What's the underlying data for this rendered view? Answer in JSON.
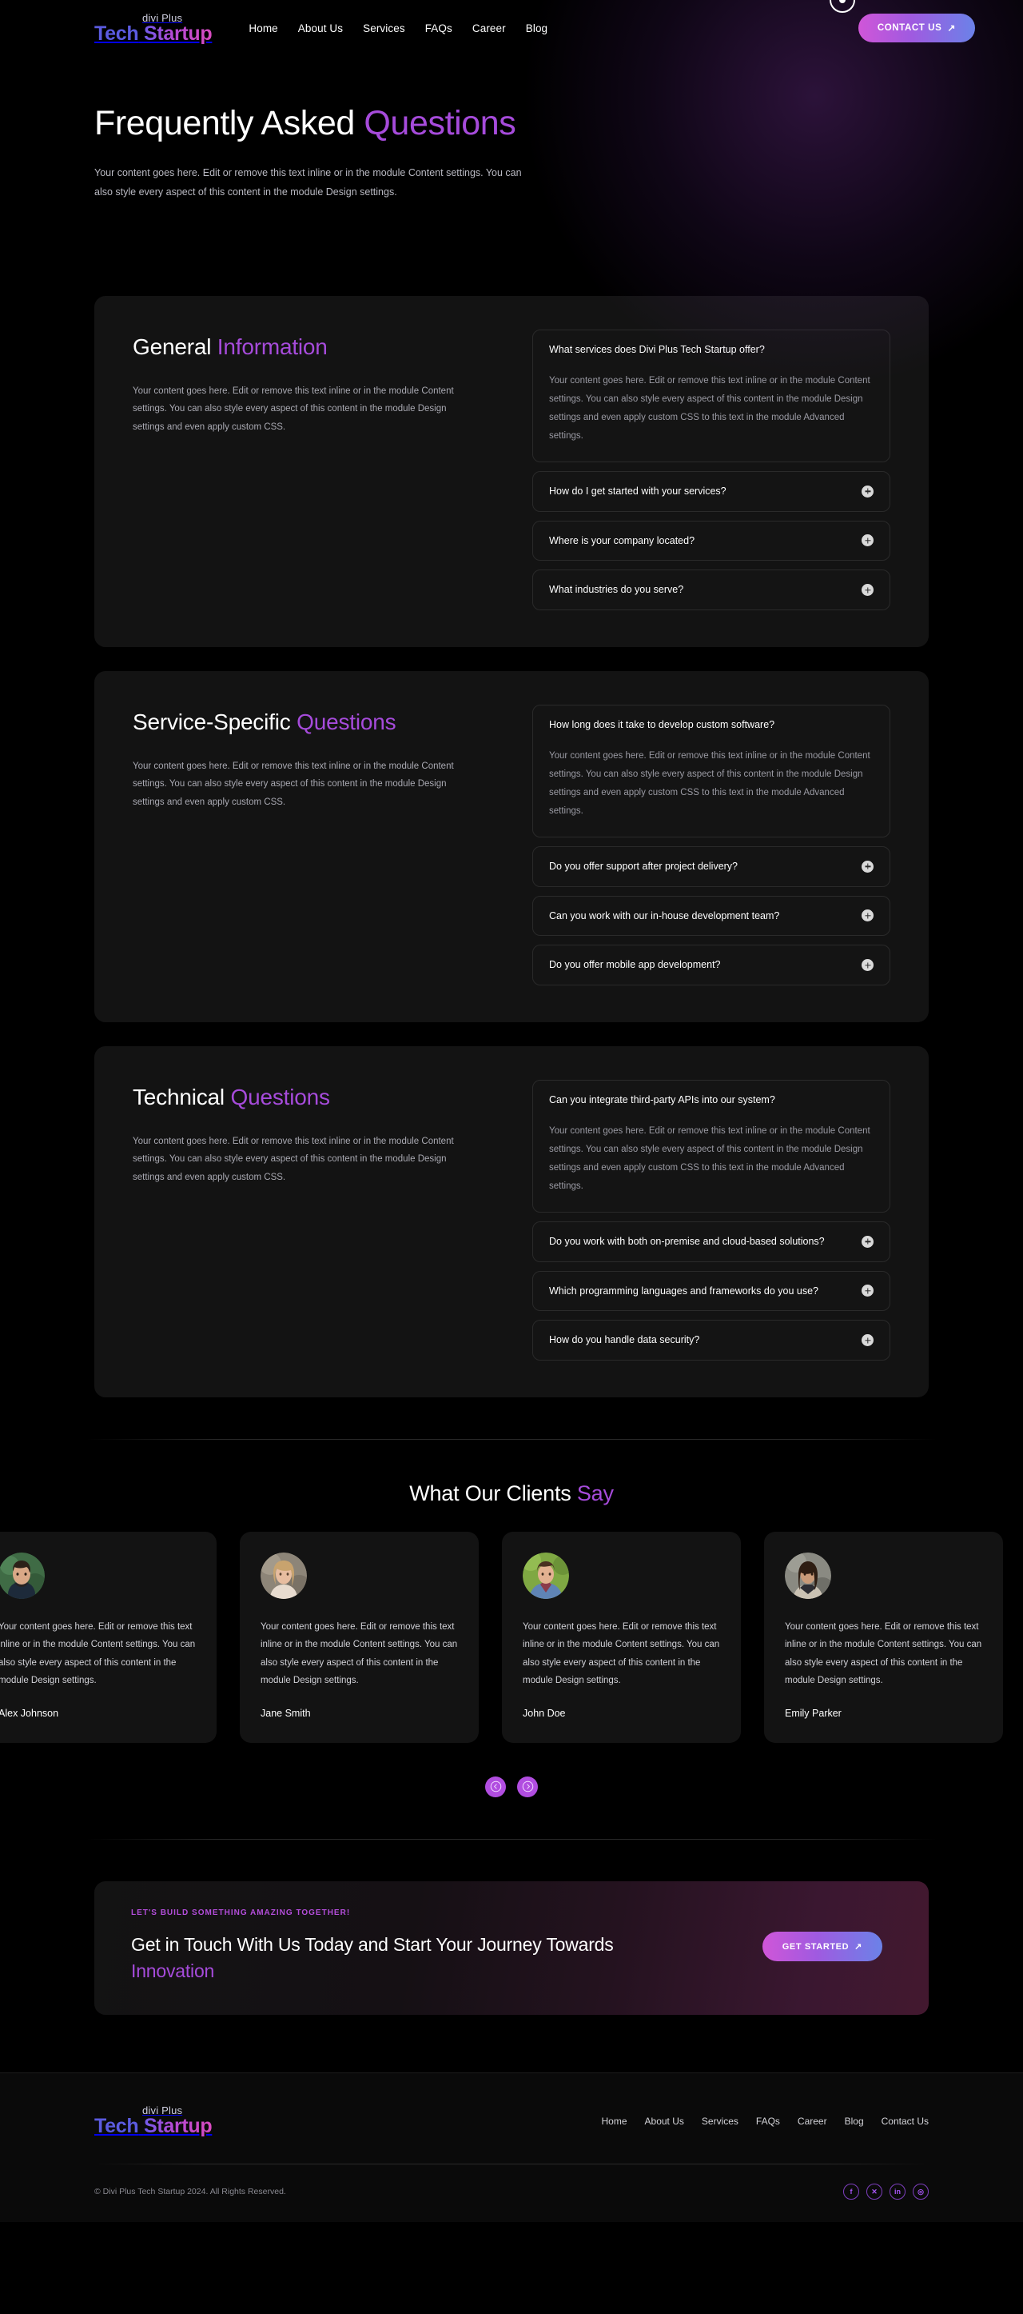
{
  "brand": {
    "sub": "divi Plus",
    "word1": "Tech",
    "word2": "Startup"
  },
  "header": {
    "nav": [
      {
        "label": "Home"
      },
      {
        "label": "About Us"
      },
      {
        "label": "Services"
      },
      {
        "label": "FAQs"
      },
      {
        "label": "Career"
      },
      {
        "label": "Blog"
      }
    ],
    "contact_label": "CONTACT US",
    "contact_arrow": "↗"
  },
  "hero": {
    "title_white": "Frequently Asked ",
    "title_accent": "Questions",
    "description": "Your content goes here. Edit or remove this text inline or in the module Content settings. You can also style every aspect of this content in the module Design settings."
  },
  "faq_sections": [
    {
      "title_white": "General ",
      "title_accent": "Information",
      "description": "Your content goes here. Edit or remove this text inline or in the module Content settings. You can also style every aspect of this content in the module Design settings and even apply custom CSS.",
      "items": [
        {
          "question": "What services does Divi Plus Tech Startup offer?",
          "answer": "Your content goes here. Edit or remove this text inline or in the module Content settings. You can also style every aspect of this content in the module Design settings and even apply custom CSS to this text in the module Advanced settings.",
          "open": true
        },
        {
          "question": "How do I get started with your services?",
          "answer": "",
          "open": false
        },
        {
          "question": "Where is your company located?",
          "answer": "",
          "open": false
        },
        {
          "question": "What industries do you serve?",
          "answer": "",
          "open": false
        }
      ]
    },
    {
      "title_white": "Service-Specific ",
      "title_accent": "Questions",
      "description": "Your content goes here. Edit or remove this text inline or in the module Content settings. You can also style every aspect of this content in the module Design settings and even apply custom CSS.",
      "items": [
        {
          "question": "How long does it take to develop custom software?",
          "answer": "Your content goes here. Edit or remove this text inline or in the module Content settings. You can also style every aspect of this content in the module Design settings and even apply custom CSS to this text in the module Advanced settings.",
          "open": true
        },
        {
          "question": "Do you offer support after project delivery?",
          "answer": "",
          "open": false
        },
        {
          "question": "Can you work with our in-house development team?",
          "answer": "",
          "open": false
        },
        {
          "question": "Do you offer mobile app development?",
          "answer": "",
          "open": false
        }
      ]
    },
    {
      "title_white": "Technical ",
      "title_accent": "Questions",
      "description": "Your content goes here. Edit or remove this text inline or in the module Content settings. You can also style every aspect of this content in the module Design settings and even apply custom CSS.",
      "items": [
        {
          "question": "Can you integrate third-party APIs into our system?",
          "answer": "Your content goes here. Edit or remove this text inline or in the module Content settings. You can also style every aspect of this content in the module Design settings and even apply custom CSS to this text in the module Advanced settings.",
          "open": true
        },
        {
          "question": "Do you work with both on-premise and cloud-based solutions?",
          "answer": "",
          "open": false
        },
        {
          "question": "Which programming languages and frameworks do you use?",
          "answer": "",
          "open": false
        },
        {
          "question": "How do you handle data security?",
          "answer": "",
          "open": false
        }
      ]
    }
  ],
  "testimonials": {
    "heading_white": "What Our Clients ",
    "heading_accent": "Say",
    "cards": [
      {
        "text": "Your content goes here. Edit or remove this text inline or in the module Content settings. You can also style every aspect of this content in the module Design settings.",
        "name": "Alex Johnson"
      },
      {
        "text": "Your content goes here. Edit or remove this text inline or in the module Content settings. You can also style every aspect of this content in the module Design settings.",
        "name": "Jane Smith"
      },
      {
        "text": "Your content goes here. Edit or remove this text inline or in the module Content settings. You can also style every aspect of this content in the module Design settings.",
        "name": "John Doe"
      },
      {
        "text": "Your content goes here. Edit or remove this text inline or in the module Content settings. You can also style every aspect of this content in the module Design settings.",
        "name": "Emily Parker"
      }
    ],
    "prev_label": "Previous",
    "next_label": "Next"
  },
  "cta": {
    "kicker": "LET'S BUILD SOMETHING AMAZING TOGETHER!",
    "title_white": "Get in Touch With Us Today and Start Your Journey Towards ",
    "title_accent": "Innovation",
    "button_label": "GET STARTED",
    "button_arrow": "↗"
  },
  "footer": {
    "nav": [
      {
        "label": "Home"
      },
      {
        "label": "About Us"
      },
      {
        "label": "Services"
      },
      {
        "label": "FAQs"
      },
      {
        "label": "Career"
      },
      {
        "label": "Blog"
      },
      {
        "label": "Contact Us"
      }
    ],
    "copyright": "© Divi Plus Tech Startup 2024. All Rights Reserved.",
    "socials": [
      {
        "name": "facebook",
        "glyph": "f"
      },
      {
        "name": "x-twitter",
        "glyph": "✕"
      },
      {
        "name": "linkedin",
        "glyph": "in"
      },
      {
        "name": "instagram",
        "glyph": "◎"
      }
    ]
  },
  "colors": {
    "accent_purple": "#a64bdb",
    "page_bg": "#000000",
    "card_bg": "#131313"
  }
}
